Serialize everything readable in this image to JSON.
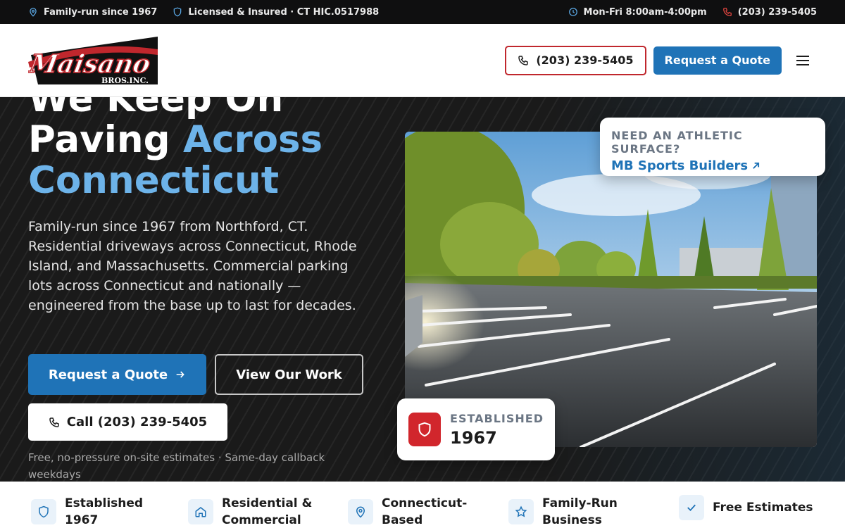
{
  "topbar": {
    "family": "Family-run since 1967",
    "licensed": "Licensed & Insured · CT HIC.0517988",
    "hours": "Mon-Fri 8:00am-4:00pm",
    "phone": "(203) 239-5405"
  },
  "header": {
    "logo_main": "Maisano",
    "logo_sub": "BROS.INC.",
    "phone_label": "(203) 239-5405",
    "quote_label": "Request a Quote"
  },
  "hero": {
    "title_line1": "We Keep On",
    "title_line2a": "Paving ",
    "title_line2b": "Across",
    "title_line3": "Connecticut",
    "description": "Family-run since 1967 from Northford, CT. Residential driveways across Connecticut, Rhode Island, and Massachusetts. Commercial parking lots across Connecticut and nationally — engineered from the base up to last for decades.",
    "quote_button": "Request a Quote",
    "work_button": "View Our Work",
    "call_button": "Call (203) 239-5405",
    "note": "Free, no-pressure on-site estimates · Same-day callback weekdays"
  },
  "sports_card": {
    "kicker": "NEED AN ATHLETIC SURFACE?",
    "link": "MB Sports Builders"
  },
  "established_card": {
    "label": "ESTABLISHED",
    "year": "1967"
  },
  "features": [
    {
      "label": "Established 1967",
      "icon": "shield-icon"
    },
    {
      "label": "Residential & Commercial",
      "icon": "home-icon"
    },
    {
      "label": "Connecticut-Based",
      "icon": "map-pin-icon"
    },
    {
      "label": "Family-Run Business",
      "icon": "star-icon"
    },
    {
      "label": "Free Estimates",
      "icon": "check-icon"
    }
  ],
  "colors": {
    "accent_blue": "#1f73b7",
    "accent_light_blue": "#6db3e9",
    "brand_red": "#c0272d",
    "topbar_bg": "#0f0f10"
  }
}
